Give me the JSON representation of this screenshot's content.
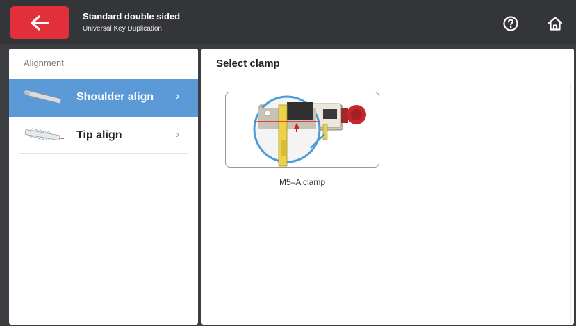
{
  "header": {
    "title": "Standard double sided",
    "subtitle": "Universal Key Duplication",
    "back_icon": "arrow-left-icon",
    "help_icon": "help-circle-icon",
    "home_icon": "home-icon",
    "accent_color": "#e2303b"
  },
  "alignment": {
    "section_label": "Alignment",
    "items": [
      {
        "label": "Shoulder align",
        "icon": "key-shoulder-icon",
        "selected": true
      },
      {
        "label": "Tip align",
        "icon": "key-tip-icon",
        "selected": false
      }
    ],
    "selected_color": "#5b9ad6"
  },
  "clamp": {
    "title": "Select clamp",
    "options": [
      {
        "label": "M5–A clamp",
        "image": "m5-a-clamp-image"
      }
    ]
  }
}
